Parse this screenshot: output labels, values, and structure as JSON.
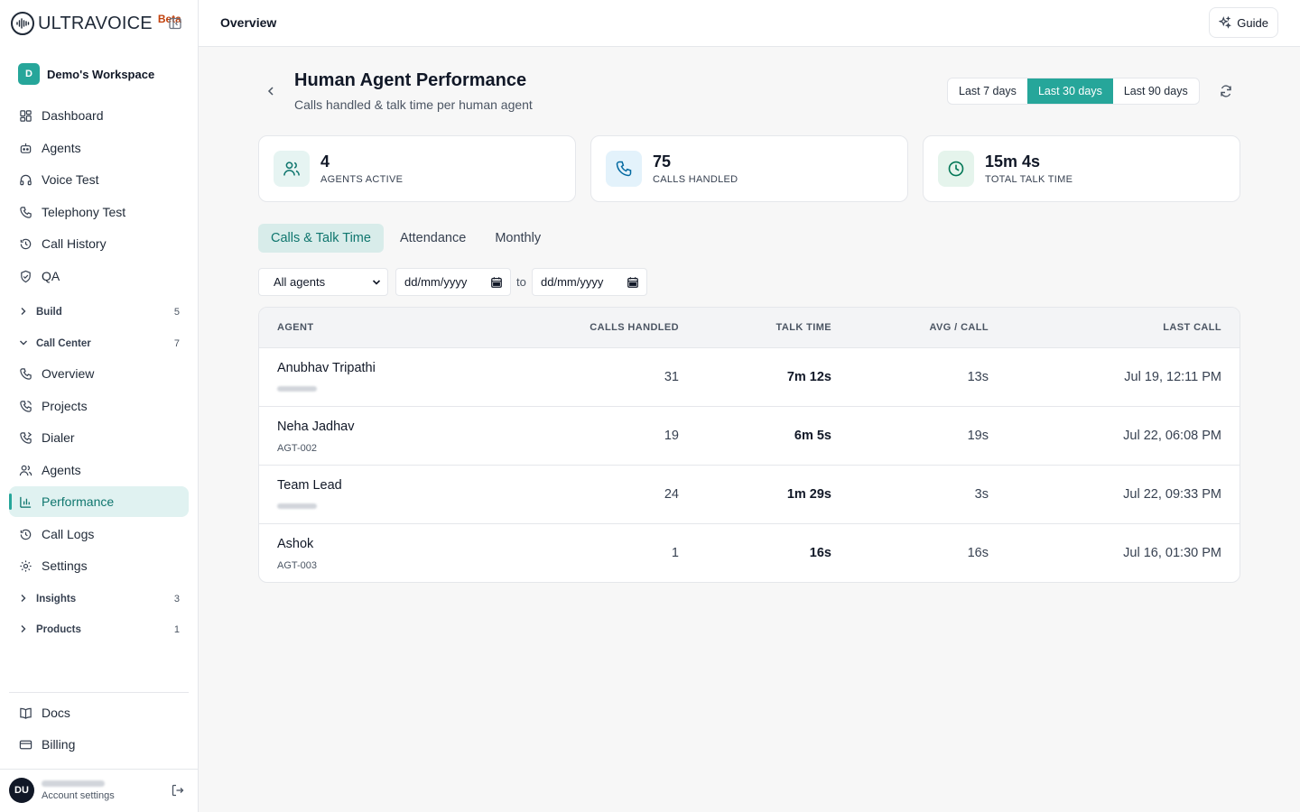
{
  "brand": {
    "name": "ULTRAVOICE",
    "badge": "Beta"
  },
  "workspace": {
    "initial": "D",
    "name": "Demo's Workspace"
  },
  "nav": {
    "dashboard": "Dashboard",
    "agents": "Agents",
    "voice_test": "Voice Test",
    "telephony_test": "Telephony Test",
    "call_history": "Call History",
    "qa": "QA",
    "build": {
      "label": "Build",
      "count": "5"
    },
    "call_center": {
      "label": "Call Center",
      "count": "7"
    },
    "cc_overview": "Overview",
    "cc_projects": "Projects",
    "cc_dialer": "Dialer",
    "cc_agents": "Agents",
    "cc_performance": "Performance",
    "cc_call_logs": "Call Logs",
    "cc_settings": "Settings",
    "insights": {
      "label": "Insights",
      "count": "3"
    },
    "products": {
      "label": "Products",
      "count": "1"
    },
    "docs": "Docs",
    "billing": "Billing"
  },
  "account": {
    "initials": "DU",
    "label": "Account settings"
  },
  "topbar": {
    "title": "Overview",
    "guide_label": "Guide"
  },
  "page": {
    "title": "Human Agent Performance",
    "subtitle": "Calls handled & talk time per human agent",
    "ranges": [
      "Last 7 days",
      "Last 30 days",
      "Last 90 days"
    ],
    "active_range": "Last 30 days"
  },
  "stats": [
    {
      "value": "4",
      "label": "AGENTS ACTIVE",
      "icon": "users-icon"
    },
    {
      "value": "75",
      "label": "CALLS HANDLED",
      "icon": "phone-icon"
    },
    {
      "value": "15m 4s",
      "label": "TOTAL TALK TIME",
      "icon": "clock-icon"
    }
  ],
  "tabs": [
    "Calls & Talk Time",
    "Attendance",
    "Monthly"
  ],
  "filters": {
    "agent_select": "All agents",
    "date_from": "dd/mm/yyyy",
    "date_to": "dd/mm/yyyy",
    "to_label": "to"
  },
  "table": {
    "headers": [
      "AGENT",
      "CALLS HANDLED",
      "TALK TIME",
      "AVG / CALL",
      "LAST CALL"
    ],
    "rows": [
      {
        "name": "Anubhav Tripathi",
        "id": "",
        "calls": "31",
        "talk": "7m 12s",
        "avg": "13s",
        "last": "Jul 19, 12:11 PM"
      },
      {
        "name": "Neha Jadhav",
        "id": "AGT-002",
        "calls": "19",
        "talk": "6m 5s",
        "avg": "19s",
        "last": "Jul 22, 06:08 PM"
      },
      {
        "name": "Team Lead",
        "id": "",
        "calls": "24",
        "talk": "1m 29s",
        "avg": "3s",
        "last": "Jul 22, 09:33 PM"
      },
      {
        "name": "Ashok",
        "id": "AGT-003",
        "calls": "1",
        "talk": "16s",
        "avg": "16s",
        "last": "Jul 16, 01:30 PM"
      }
    ]
  },
  "colors": {
    "accent": "#26a69a",
    "accent_light": "#e0f2f1",
    "orange": "#c2410c"
  }
}
